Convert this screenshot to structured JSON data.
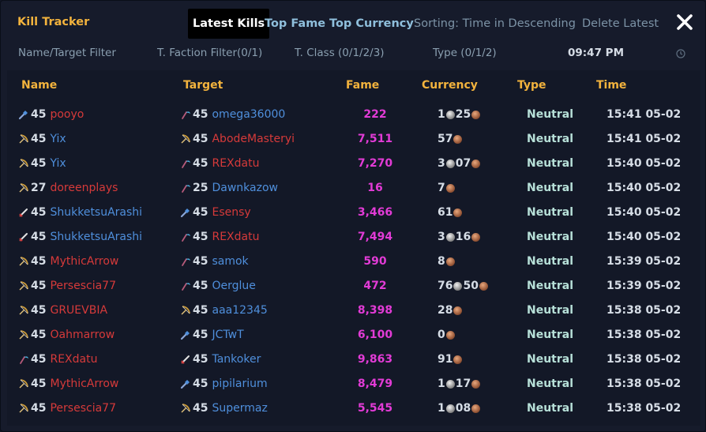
{
  "header": {
    "title": "Kill Tracker",
    "tabs": [
      {
        "label": "Latest Kills",
        "active": true
      },
      {
        "label": "Top Fame",
        "active": false
      },
      {
        "label": "Top Currency",
        "active": false
      }
    ],
    "sorting_label": "Sorting: Time in Descending",
    "delete_label": "Delete Latest",
    "close_icon": "close-icon"
  },
  "filters": {
    "name_target": "Name/Target Filter",
    "faction": "T. Faction Filter(0/1)",
    "class": "T. Class (0/1/2/3)",
    "type": "Type (0/1/2)",
    "clock": "09:47 PM"
  },
  "columns": [
    "Name",
    "Target",
    "Fame",
    "Currency",
    "Type",
    "Time"
  ],
  "colors": {
    "accent": "#f3b33d",
    "red_faction": "#d63a3a",
    "blue_faction": "#4f8fdc",
    "fame": "#e23bd6",
    "type": "#b7e0d8"
  },
  "rows": [
    {
      "n_icon": "wand-icon",
      "n_lvl": "45",
      "n_name": "pooyo",
      "n_fac": "red",
      "t_icon": "scythe-icon",
      "t_lvl": "45",
      "t_name": "omega36000",
      "t_fac": "blue",
      "fame": "222",
      "cur": [
        [
          "1",
          "s"
        ],
        [
          "25",
          "b"
        ]
      ],
      "type": "Neutral",
      "time": "15:41 05-02"
    },
    {
      "n_icon": "bow-icon",
      "n_lvl": "45",
      "n_name": "Yix",
      "n_fac": "blue",
      "t_icon": "bow-icon",
      "t_lvl": "45",
      "t_name": "AbodeMasteryi",
      "t_fac": "red",
      "fame": "7,511",
      "cur": [
        [
          "57",
          "b"
        ]
      ],
      "type": "Neutral",
      "time": "15:41 05-02"
    },
    {
      "n_icon": "bow-icon",
      "n_lvl": "45",
      "n_name": "Yix",
      "n_fac": "blue",
      "t_icon": "scythe-icon",
      "t_lvl": "45",
      "t_name": "REXdatu",
      "t_fac": "red",
      "fame": "7,270",
      "cur": [
        [
          "3",
          "s"
        ],
        [
          "07",
          "b"
        ]
      ],
      "type": "Neutral",
      "time": "15:40 05-02"
    },
    {
      "n_icon": "bow-icon",
      "n_lvl": "27",
      "n_name": "doreenplays",
      "n_fac": "red",
      "t_icon": "scythe-icon",
      "t_lvl": "25",
      "t_name": "Dawnkazow",
      "t_fac": "blue",
      "fame": "16",
      "cur": [
        [
          "7",
          "b"
        ]
      ],
      "type": "Neutral",
      "time": "15:40 05-02"
    },
    {
      "n_icon": "sword-icon",
      "n_lvl": "45",
      "n_name": "ShukketsuArashi",
      "n_fac": "blue",
      "t_icon": "wand-icon",
      "t_lvl": "45",
      "t_name": "Esensy",
      "t_fac": "red",
      "fame": "3,466",
      "cur": [
        [
          "61",
          "b"
        ]
      ],
      "type": "Neutral",
      "time": "15:40 05-02"
    },
    {
      "n_icon": "sword-icon",
      "n_lvl": "45",
      "n_name": "ShukketsuArashi",
      "n_fac": "blue",
      "t_icon": "scythe-icon",
      "t_lvl": "45",
      "t_name": "REXdatu",
      "t_fac": "red",
      "fame": "7,494",
      "cur": [
        [
          "3",
          "s"
        ],
        [
          "16",
          "b"
        ]
      ],
      "type": "Neutral",
      "time": "15:40 05-02"
    },
    {
      "n_icon": "bow-icon",
      "n_lvl": "45",
      "n_name": "MythicArrow",
      "n_fac": "red",
      "t_icon": "scythe-icon",
      "t_lvl": "45",
      "t_name": "samok",
      "t_fac": "blue",
      "fame": "590",
      "cur": [
        [
          "8",
          "b"
        ]
      ],
      "type": "Neutral",
      "time": "15:39 05-02"
    },
    {
      "n_icon": "bow-icon",
      "n_lvl": "45",
      "n_name": "Persescia77",
      "n_fac": "red",
      "t_icon": "scythe-icon",
      "t_lvl": "45",
      "t_name": "Oerglue",
      "t_fac": "blue",
      "fame": "472",
      "cur": [
        [
          "76",
          "s"
        ],
        [
          "50",
          "b"
        ]
      ],
      "type": "Neutral",
      "time": "15:39 05-02"
    },
    {
      "n_icon": "bow-icon",
      "n_lvl": "45",
      "n_name": "GRUEVBIA",
      "n_fac": "red",
      "t_icon": "bow-icon",
      "t_lvl": "45",
      "t_name": "aaa12345",
      "t_fac": "blue",
      "fame": "8,398",
      "cur": [
        [
          "28",
          "b"
        ]
      ],
      "type": "Neutral",
      "time": "15:38 05-02"
    },
    {
      "n_icon": "bow-icon",
      "n_lvl": "45",
      "n_name": "Oahmarrow",
      "n_fac": "red",
      "t_icon": "wand-icon",
      "t_lvl": "45",
      "t_name": "JCTwT",
      "t_fac": "blue",
      "fame": "6,100",
      "cur": [
        [
          "0",
          "b"
        ]
      ],
      "type": "Neutral",
      "time": "15:38 05-02"
    },
    {
      "n_icon": "scythe-icon",
      "n_lvl": "45",
      "n_name": "REXdatu",
      "n_fac": "red",
      "t_icon": "sword-icon",
      "t_lvl": "45",
      "t_name": "Tankoker",
      "t_fac": "blue",
      "fame": "9,863",
      "cur": [
        [
          "91",
          "b"
        ]
      ],
      "type": "Neutral",
      "time": "15:38 05-02"
    },
    {
      "n_icon": "bow-icon",
      "n_lvl": "45",
      "n_name": "MythicArrow",
      "n_fac": "red",
      "t_icon": "wand-icon",
      "t_lvl": "45",
      "t_name": "pipilarium",
      "t_fac": "blue",
      "fame": "8,479",
      "cur": [
        [
          "1",
          "s"
        ],
        [
          "17",
          "b"
        ]
      ],
      "type": "Neutral",
      "time": "15:38 05-02"
    },
    {
      "n_icon": "bow-icon",
      "n_lvl": "45",
      "n_name": "Persescia77",
      "n_fac": "red",
      "t_icon": "bow-icon",
      "t_lvl": "45",
      "t_name": "Supermaz",
      "t_fac": "blue",
      "fame": "5,545",
      "cur": [
        [
          "1",
          "s"
        ],
        [
          "08",
          "b"
        ]
      ],
      "type": "Neutral",
      "time": "15:38 05-02"
    }
  ]
}
